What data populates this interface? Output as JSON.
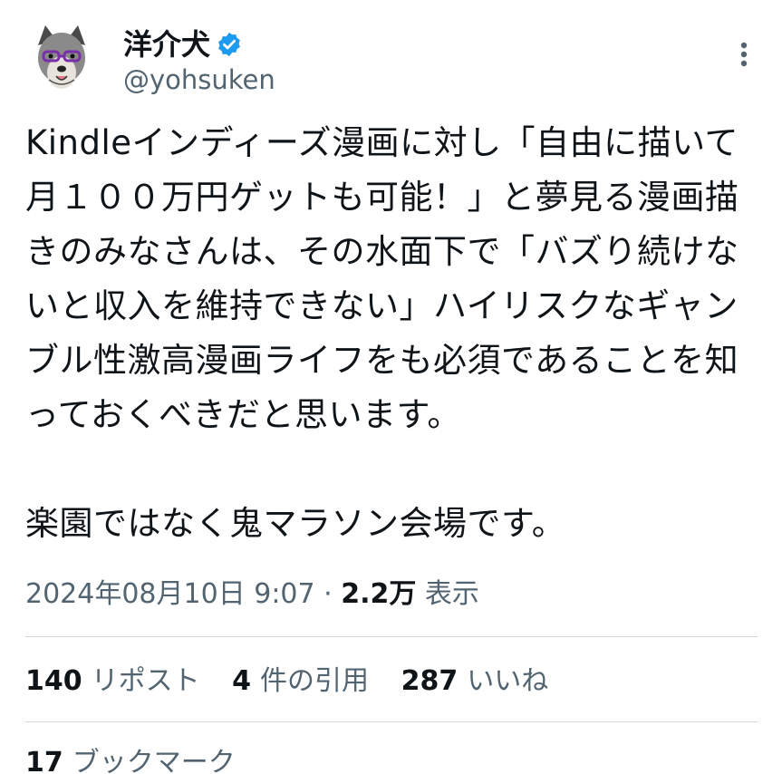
{
  "author": {
    "display_name": "洋介犬",
    "handle": "@yohsuken",
    "verified": true,
    "avatar_icon": "dog-avatar-icon"
  },
  "tweet": {
    "text": "Kindleインディーズ漫画に対し「自由に描いて月１００万円ゲットも可能！」と夢見る漫画描きのみなさんは、その水面下で「バズり続けないと収入を維持できない」ハイリスクなギャンブル性激高漫画ライフをも必須であることを知っておくべきだと思います。\n\n楽園ではなく鬼マラソン会場です。"
  },
  "meta": {
    "datetime": "2024年08月10日 9:07",
    "separator": " · ",
    "views_count": "2.2万",
    "views_label": " 表示"
  },
  "stats": {
    "reposts": {
      "num": "140",
      "label": "リポスト"
    },
    "quotes": {
      "num": "4",
      "label": "件の引用"
    },
    "likes": {
      "num": "287",
      "label": "いいね"
    },
    "bookmarks": {
      "num": "17",
      "label": "ブックマーク"
    }
  },
  "colors": {
    "text": "#0f1419",
    "secondary": "#536471",
    "verified_blue": "#1d9bf0",
    "divider": "#cfd9de"
  }
}
